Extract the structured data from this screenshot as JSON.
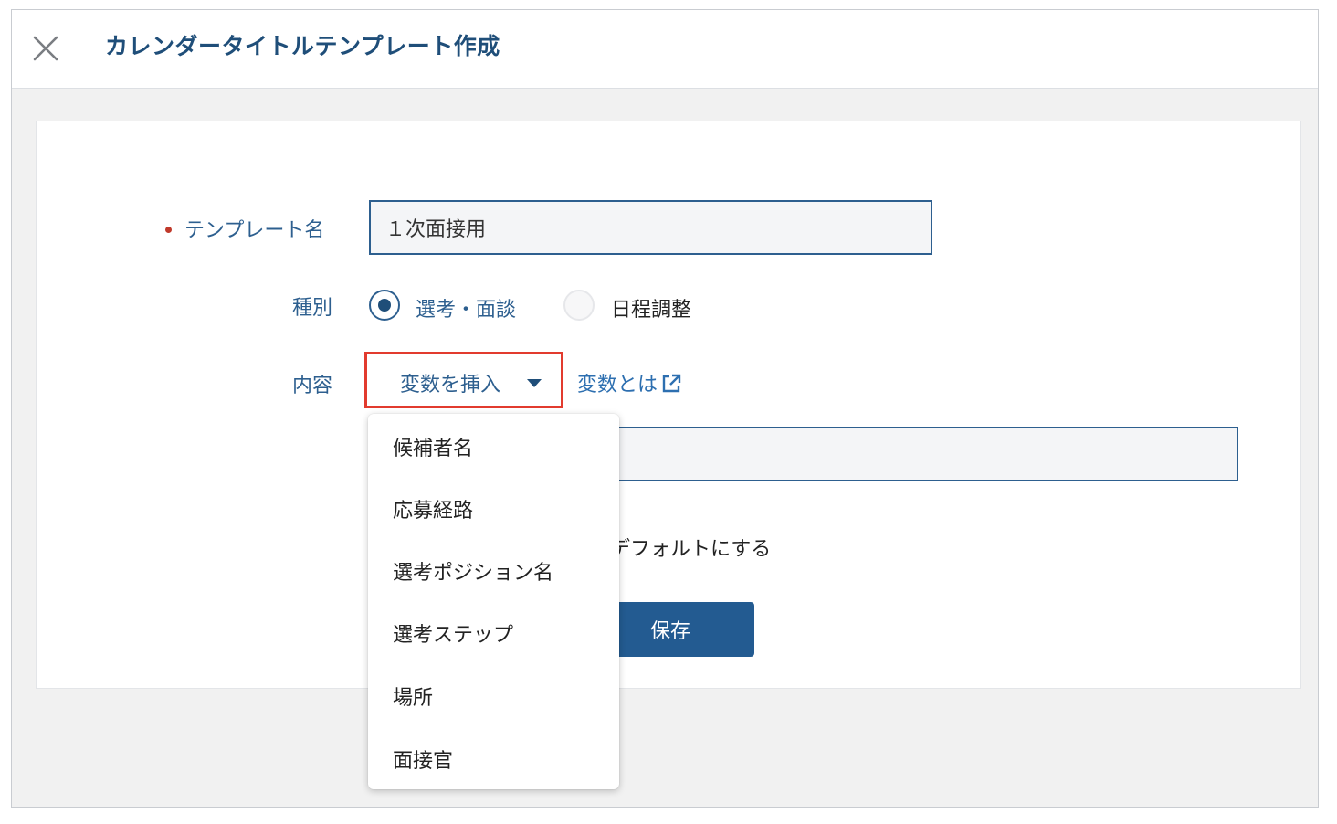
{
  "dialog": {
    "title": "カレンダータイトルテンプレート作成",
    "close_icon": "close-icon"
  },
  "form": {
    "template_name": {
      "label": "テンプレート名",
      "value": "１次面接用"
    },
    "type": {
      "label": "種別",
      "options": [
        {
          "label": "選考・面談",
          "checked": true
        },
        {
          "label": "日程調整",
          "checked": false
        }
      ]
    },
    "content": {
      "label": "内容",
      "insert_button_label": "変数を挿入",
      "help_link_label": "変数とは",
      "help_link_icon": "external-link-icon"
    },
    "default_checkbox_label": "デフォルトにする",
    "save_label": "保存"
  },
  "variables_menu": {
    "items": [
      "候補者名",
      "応募経路",
      "選考ポジション名",
      "選考ステップ",
      "場所",
      "面接官"
    ]
  },
  "colors": {
    "primary": "#1f4e79",
    "link": "#2d6fb0",
    "highlight_border": "#e23b2e",
    "required": "#c0392b",
    "save_button": "#235b91"
  }
}
